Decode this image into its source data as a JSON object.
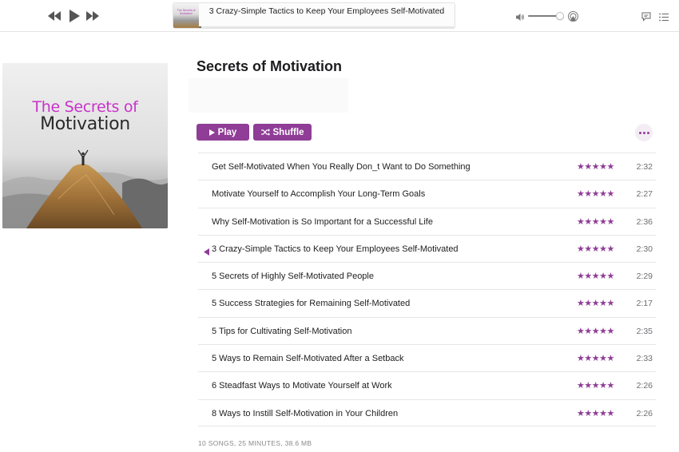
{
  "colors": {
    "accent": "#8f3d96",
    "art_title_accent": "#c932c9"
  },
  "toolbar": {
    "prev_icon": "rewind-icon",
    "play_icon": "play-icon",
    "next_icon": "fast-forward-icon",
    "now_playing_title": "3 Crazy-Simple Tactics to Keep Your Employees Self-Motivated",
    "progress": 0.01,
    "volume": 0.9,
    "airplay_icon": "airplay-icon",
    "lyrics_icon": "lyrics-icon",
    "queue_icon": "queue-list-icon"
  },
  "album": {
    "art_line1": "The Secrets of",
    "art_line2": "Motivation",
    "title": "Secrets of Motivation",
    "play_label": "Play",
    "shuffle_label": "Shuffle",
    "more_icon": "more-icon"
  },
  "tracks": [
    {
      "title": "Get Self-Motivated When You Really Don_t Want to Do Something",
      "rating": 5,
      "stars": "★★★★★",
      "duration": "2:32",
      "playing": false
    },
    {
      "title": "Motivate Yourself to Accomplish Your Long-Term Goals",
      "rating": 5,
      "stars": "★★★★★",
      "duration": "2:27",
      "playing": false
    },
    {
      "title": "Why Self-Motivation is So Important for a Successful Life",
      "rating": 5,
      "stars": "★★★★★",
      "duration": "2:36",
      "playing": false
    },
    {
      "title": "3 Crazy-Simple Tactics to Keep Your Employees Self-Motivated",
      "rating": 5,
      "stars": "★★★★★",
      "duration": "2:30",
      "playing": true
    },
    {
      "title": "5 Secrets of Highly Self-Motivated People",
      "rating": 5,
      "stars": "★★★★★",
      "duration": "2:29",
      "playing": false
    },
    {
      "title": "5 Success Strategies for Remaining Self-Motivated",
      "rating": 5,
      "stars": "★★★★★",
      "duration": "2:17",
      "playing": false
    },
    {
      "title": "5 Tips for Cultivating Self-Motivation",
      "rating": 5,
      "stars": "★★★★★",
      "duration": "2:35",
      "playing": false
    },
    {
      "title": "5 Ways to Remain Self-Motivated After a Setback",
      "rating": 5,
      "stars": "★★★★★",
      "duration": "2:33",
      "playing": false
    },
    {
      "title": "6 Steadfast Ways to Motivate Yourself at Work",
      "rating": 5,
      "stars": "★★★★★",
      "duration": "2:26",
      "playing": false
    },
    {
      "title": "8 Ways to Instill Self-Motivation in Your Children",
      "rating": 5,
      "stars": "★★★★★",
      "duration": "2:26",
      "playing": false
    }
  ],
  "footer": {
    "summary": "10 SONGS, 25 MINUTES, 38.6 MB"
  }
}
